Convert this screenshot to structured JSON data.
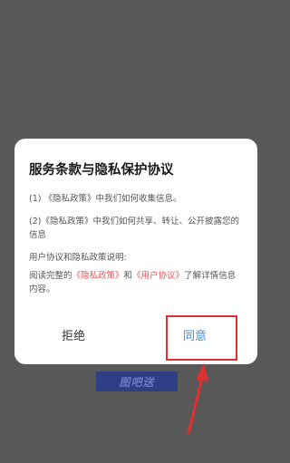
{
  "dialog": {
    "title": "服务条款与隐私保护协议",
    "item1": "(1) 《隐私政策》中我们如何收集信息。",
    "item2": "(2)《隐私政策》中我们如何共享、转让、公开披露您的信息",
    "note_label": "用户协议和隐私政策说明:",
    "read_prefix": "阅读完整的",
    "privacy_link": "《隐私政策》",
    "and_text": "和",
    "user_link": "《用户协议》",
    "read_suffix": "了解详情信息内容。",
    "refuse_label": "拒绝",
    "agree_label": "同意"
  },
  "background": {
    "button_label": "图吧送"
  },
  "colors": {
    "overlay": "#595959",
    "link": "#e85555",
    "agree": "#3b8ef0",
    "annotation": "#e02f2f"
  }
}
